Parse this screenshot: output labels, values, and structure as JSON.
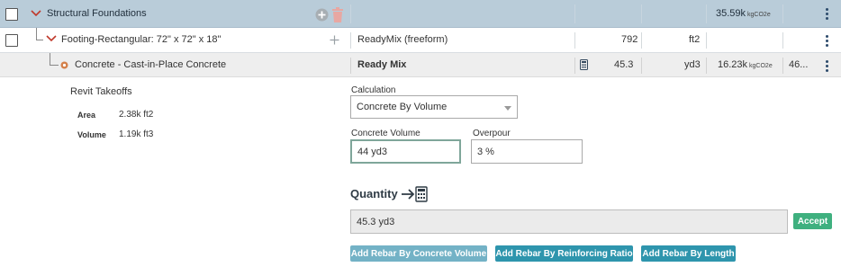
{
  "rows": [
    {
      "title": "Structural Foundations",
      "value": "35.59k",
      "value_unit": "kgCO2e"
    },
    {
      "title": "Footing-Rectangular: 72\" x 72\" x 18\"",
      "material": "ReadyMix (freeform)",
      "quantity": "792",
      "unit": "ft2"
    },
    {
      "title": "Concrete - Cast-in-Place Concrete",
      "material": "Ready Mix",
      "quantity": "45.3",
      "unit": "yd3",
      "value": "16.23k",
      "value_unit": "kgCO2e",
      "extra": "46..."
    }
  ],
  "revit": {
    "title": "Revit Takeoffs",
    "items": [
      {
        "label": "Area",
        "value": "2.38k ft2"
      },
      {
        "label": "Volume",
        "value": "1.19k ft3"
      }
    ]
  },
  "form": {
    "calculation_label": "Calculation",
    "calculation_value": "Concrete By Volume",
    "concrete_volume_label": "Concrete Volume",
    "concrete_volume_value": "44 yd3",
    "overpour_label": "Overpour",
    "overpour_value": "3 %",
    "quantity_title": "Quantity",
    "quantity_value": "45.3 yd3",
    "accept_label": "Accept"
  },
  "buttons": [
    {
      "label": "Add Rebar By Concrete Volume"
    },
    {
      "label": "Add Rebar By Reinforcing Ratio"
    },
    {
      "label": "Add Rebar By Length"
    }
  ],
  "colors": {
    "header_bg": "#b9ccd9",
    "accent_red": "#c0392b",
    "accept_green": "#3fb07f",
    "rebar_teal": "#2e95ad",
    "rebar_teal_light": "#73b2c6"
  }
}
